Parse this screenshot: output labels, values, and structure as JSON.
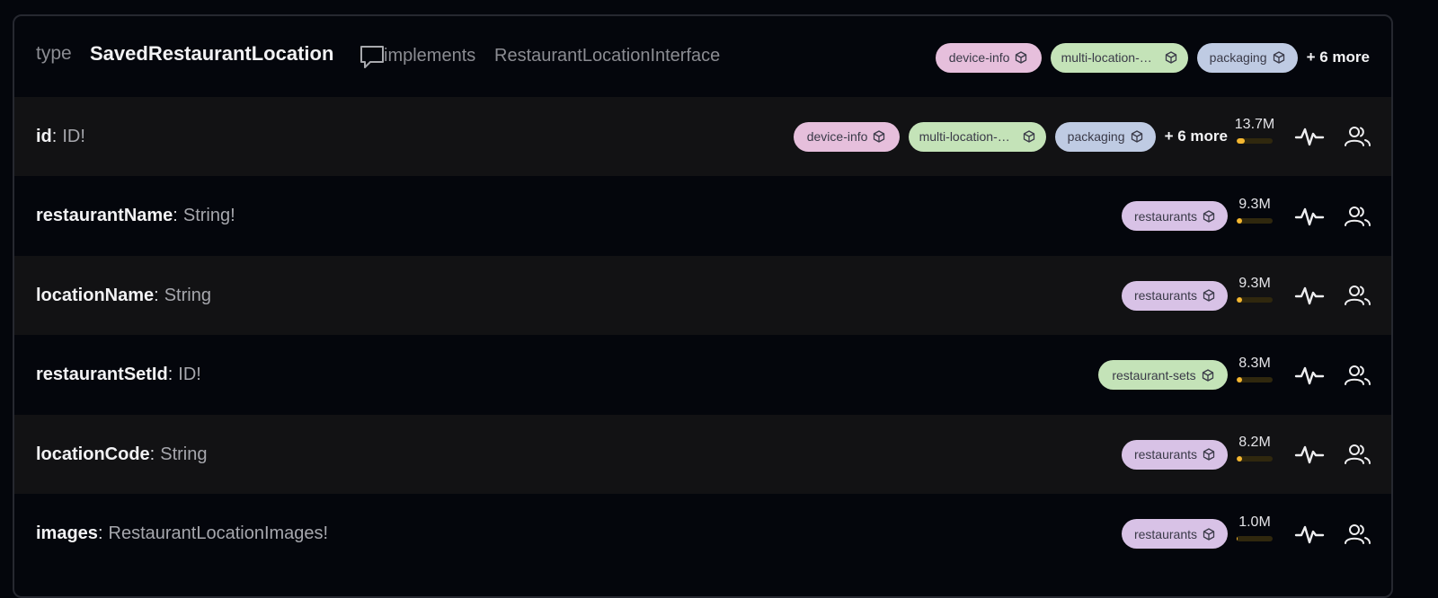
{
  "header": {
    "keyword": "type",
    "type_name": "SavedRestaurantLocation",
    "implements_keyword": "implements",
    "interface_name": "RestaurantLocationInterface",
    "tags": [
      {
        "label": "device-info",
        "color": "#e6bfdc"
      },
      {
        "label": "multi-location-mg...",
        "color": "#c4e3b8"
      },
      {
        "label": "packaging",
        "color": "#bfcbe3"
      }
    ],
    "more_label": "+ 6 more"
  },
  "fields": [
    {
      "name": "id",
      "type": "ID!",
      "tags": [
        {
          "label": "device-info",
          "color": "#e6bfdc"
        },
        {
          "label": "multi-location-mg...",
          "color": "#c4e3b8"
        },
        {
          "label": "packaging",
          "color": "#bfcbe3"
        }
      ],
      "more_label": "+ 6 more",
      "usage": "13.7M",
      "usage_fraction": 0.22
    },
    {
      "name": "restaurantName",
      "type": "String!",
      "tags": [
        {
          "label": "restaurants",
          "color": "#d8c2e6"
        }
      ],
      "usage": "9.3M",
      "usage_fraction": 0.15
    },
    {
      "name": "locationName",
      "type": "String",
      "tags": [
        {
          "label": "restaurants",
          "color": "#d8c2e6"
        }
      ],
      "usage": "9.3M",
      "usage_fraction": 0.15
    },
    {
      "name": "restaurantSetId",
      "type": "ID!",
      "tags": [
        {
          "label": "restaurant-sets",
          "color": "#c4e3b8"
        }
      ],
      "usage": "8.3M",
      "usage_fraction": 0.14
    },
    {
      "name": "locationCode",
      "type": "String",
      "tags": [
        {
          "label": "restaurants",
          "color": "#d8c2e6"
        }
      ],
      "usage": "8.2M",
      "usage_fraction": 0.14
    },
    {
      "name": "images",
      "type": "RestaurantLocationImages!",
      "tags": [
        {
          "label": "restaurants",
          "color": "#d8c2e6"
        }
      ],
      "usage": "1.0M",
      "usage_fraction": 0.02
    }
  ],
  "colors": {
    "background": "#04060c",
    "row_alt": "#121214",
    "usage_bar_fill": "#f4b731",
    "usage_bar_track": "#30280e"
  },
  "icons": {
    "tag_icon": "package-cube-icon",
    "header_icon": "comment-icon",
    "row_icons": [
      "activity-pulse-icon",
      "users-icon"
    ]
  }
}
